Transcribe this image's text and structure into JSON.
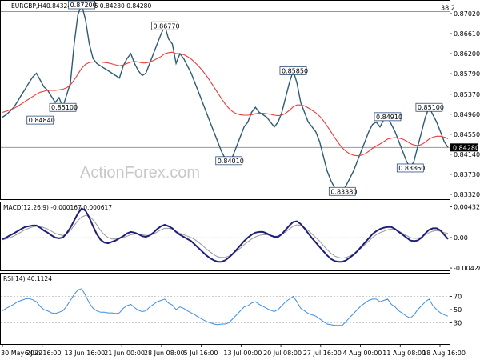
{
  "chart_data": {
    "type": "line",
    "price": {
      "header_symbol": "EURGBP,H4",
      "header_values": "0.84324 0.84476 0.84280 0.84280",
      "ylim": [
        0.8327,
        0.872
      ],
      "y_ticks": [
        "0.87020",
        "0.86610",
        "0.86200",
        "0.85790",
        "0.85370",
        "0.84960",
        "0.84550",
        "0.84140",
        "0.83730",
        "0.83320"
      ],
      "current_price": "0.84280",
      "fib_label": "38.2",
      "fib_level": 0.8706,
      "series": [
        {
          "name": "close",
          "color": "#2e5a74",
          "values": [
            0.849,
            0.8495,
            0.8502,
            0.851,
            0.8522,
            0.8535,
            0.8547,
            0.856,
            0.8572,
            0.858,
            0.8566,
            0.8552,
            0.8545,
            0.8532,
            0.852,
            0.853,
            0.851,
            0.8535,
            0.856,
            0.864,
            0.87,
            0.872,
            0.869,
            0.864,
            0.861,
            0.86,
            0.8595,
            0.859,
            0.8585,
            0.858,
            0.8575,
            0.857,
            0.8595,
            0.861,
            0.862,
            0.86,
            0.8585,
            0.8575,
            0.858,
            0.86,
            0.862,
            0.864,
            0.866,
            0.8677,
            0.865,
            0.864,
            0.86,
            0.862,
            0.861,
            0.8595,
            0.858,
            0.856,
            0.854,
            0.852,
            0.85,
            0.848,
            0.846,
            0.844,
            0.842,
            0.8405,
            0.8401,
            0.841,
            0.843,
            0.845,
            0.847,
            0.848,
            0.85,
            0.851,
            0.85,
            0.8495,
            0.849,
            0.848,
            0.847,
            0.848,
            0.85,
            0.853,
            0.856,
            0.8585,
            0.856,
            0.852,
            0.85,
            0.848,
            0.847,
            0.846,
            0.844,
            0.841,
            0.838,
            0.836,
            0.8345,
            0.834,
            0.8338,
            0.835,
            0.8365,
            0.838,
            0.84,
            0.842,
            0.844,
            0.846,
            0.8475,
            0.848,
            0.847,
            0.8485,
            0.8491,
            0.8475,
            0.846,
            0.844,
            0.842,
            0.84,
            0.8386,
            0.84,
            0.843,
            0.846,
            0.849,
            0.851,
            0.8495,
            0.848,
            0.846,
            0.844,
            0.8428
          ]
        },
        {
          "name": "ma",
          "color": "#e83c3c",
          "values": [
            0.85,
            0.8502,
            0.8505,
            0.8508,
            0.8512,
            0.8517,
            0.8522,
            0.8527,
            0.8532,
            0.8537,
            0.8541,
            0.8543,
            0.8545,
            0.8545,
            0.8545,
            0.8546,
            0.8547,
            0.855,
            0.8556,
            0.8566,
            0.8578,
            0.859,
            0.8598,
            0.8602,
            0.8603,
            0.8603,
            0.8603,
            0.8602,
            0.8601,
            0.8599,
            0.8597,
            0.8595,
            0.8597,
            0.86,
            0.8603,
            0.8604,
            0.8603,
            0.8601,
            0.8601,
            0.8603,
            0.8606,
            0.861,
            0.8614,
            0.862,
            0.8622,
            0.8623,
            0.862,
            0.862,
            0.8618,
            0.8614,
            0.8609,
            0.8602,
            0.8594,
            0.8585,
            0.8575,
            0.8564,
            0.8552,
            0.854,
            0.8528,
            0.8517,
            0.8508,
            0.8501,
            0.8497,
            0.8495,
            0.8494,
            0.8494,
            0.8495,
            0.8497,
            0.8498,
            0.8498,
            0.8497,
            0.8496,
            0.8494,
            0.8493,
            0.8494,
            0.8498,
            0.8504,
            0.8511,
            0.8515,
            0.8515,
            0.8513,
            0.8509,
            0.8504,
            0.8499,
            0.8492,
            0.8483,
            0.8472,
            0.846,
            0.8448,
            0.8437,
            0.8427,
            0.842,
            0.8415,
            0.8412,
            0.8411,
            0.8412,
            0.8415,
            0.842,
            0.8426,
            0.8431,
            0.8435,
            0.844,
            0.8445,
            0.8447,
            0.8448,
            0.8447,
            0.8445,
            0.8441,
            0.8436,
            0.8433,
            0.8432,
            0.8434,
            0.8439,
            0.8445,
            0.8449,
            0.8451,
            0.8451,
            0.8449,
            0.8446
          ]
        }
      ],
      "labels": [
        {
          "text": "0.84840",
          "i": 10,
          "value": 0.8484
        },
        {
          "text": "0.87200",
          "i": 21,
          "value": 0.872
        },
        {
          "text": "0.85100",
          "i": 16,
          "value": 0.851
        },
        {
          "text": "0.86770",
          "i": 43,
          "value": 0.8677
        },
        {
          "text": "0.84010",
          "i": 60,
          "value": 0.8401
        },
        {
          "text": "0.85850",
          "i": 77,
          "value": 0.8585
        },
        {
          "text": "0.83380",
          "i": 90,
          "value": 0.8338
        },
        {
          "text": "0.84910",
          "i": 102,
          "value": 0.8491
        },
        {
          "text": "0.83860",
          "i": 108,
          "value": 0.8386
        },
        {
          "text": "0.85100",
          "i": 113,
          "value": 0.851
        }
      ]
    },
    "macd": {
      "header": "MACD(12,26,9) -0.000167 0.000617",
      "ylim": [
        -0.0045,
        0.0045
      ],
      "y_ticks": [
        "0.004325",
        "0.00",
        "-0.004288"
      ],
      "series": [
        {
          "name": "signal",
          "color": "#999999",
          "values": [
            -0.0003,
            -0.0002,
            0.0,
            0.0002,
            0.0005,
            0.0008,
            0.0011,
            0.0013,
            0.0015,
            0.0016,
            0.0016,
            0.0014,
            0.0012,
            0.0009,
            0.0006,
            0.0004,
            0.0003,
            0.0005,
            0.001,
            0.0017,
            0.0024,
            0.0029,
            0.0031,
            0.003,
            0.0025,
            0.0018,
            0.001,
            0.0004,
            0.0,
            -0.0002,
            -0.0002,
            -0.0001,
            0.0,
            0.0002,
            0.0004,
            0.0005,
            0.0005,
            0.0004,
            0.0003,
            0.0003,
            0.0005,
            0.0008,
            0.0011,
            0.0013,
            0.0013,
            0.0012,
            0.0009,
            0.0006,
            0.0004,
            0.0002,
            0.0,
            -0.0003,
            -0.0007,
            -0.0011,
            -0.0016,
            -0.002,
            -0.0024,
            -0.0027,
            -0.0028,
            -0.0028,
            -0.0026,
            -0.0023,
            -0.0019,
            -0.0015,
            -0.001,
            -0.0006,
            -0.0002,
            0.0001,
            0.0003,
            0.0004,
            0.0004,
            0.0003,
            0.0002,
            0.0002,
            0.0004,
            0.0008,
            0.0012,
            0.0016,
            0.0018,
            0.0017,
            0.0014,
            0.001,
            0.0005,
            0.0,
            -0.0005,
            -0.0011,
            -0.0017,
            -0.0022,
            -0.0026,
            -0.0028,
            -0.0029,
            -0.0028,
            -0.0026,
            -0.0023,
            -0.0019,
            -0.0015,
            -0.001,
            -0.0005,
            0.0,
            0.0004,
            0.0007,
            0.0009,
            0.0011,
            0.0012,
            0.0011,
            0.0009,
            0.0006,
            0.0003,
            0.0,
            -0.0001,
            -0.0001,
            0.0001,
            0.0004,
            0.0007,
            0.0009,
            0.001,
            0.0009,
            0.0007,
            0.0006
          ]
        },
        {
          "name": "macd",
          "color": "#1e1e7a",
          "values": [
            -0.0002,
            0.0,
            0.0003,
            0.0006,
            0.0009,
            0.0012,
            0.0015,
            0.0016,
            0.0017,
            0.0017,
            0.0014,
            0.001,
            0.0007,
            0.0003,
            0.0,
            -0.0001,
            0.0,
            0.0006,
            0.0014,
            0.0024,
            0.0034,
            0.0041,
            0.0038,
            0.0028,
            0.0016,
            0.0005,
            -0.0003,
            -0.0007,
            -0.0008,
            -0.0006,
            -0.0004,
            -0.0001,
            0.0002,
            0.0006,
            0.0008,
            0.0007,
            0.0005,
            0.0002,
            0.0001,
            0.0003,
            0.0007,
            0.0012,
            0.0016,
            0.0018,
            0.0016,
            0.0013,
            0.0008,
            0.0004,
            0.0001,
            -0.0002,
            -0.0005,
            -0.001,
            -0.0015,
            -0.002,
            -0.0025,
            -0.0029,
            -0.0032,
            -0.0034,
            -0.0034,
            -0.0032,
            -0.0028,
            -0.0023,
            -0.0017,
            -0.0011,
            -0.0005,
            0.0,
            0.0004,
            0.0007,
            0.0008,
            0.0008,
            0.0006,
            0.0003,
            0.0001,
            0.0001,
            0.0005,
            0.0011,
            0.0017,
            0.0022,
            0.0023,
            0.0019,
            0.0013,
            0.0006,
            -0.0001,
            -0.0007,
            -0.0013,
            -0.0019,
            -0.0025,
            -0.003,
            -0.0033,
            -0.0034,
            -0.0034,
            -0.0032,
            -0.0028,
            -0.0024,
            -0.0019,
            -0.0013,
            -0.0007,
            -0.0001,
            0.0005,
            0.0009,
            0.0012,
            0.0014,
            0.0015,
            0.0015,
            0.0012,
            0.0008,
            0.0004,
            0.0,
            -0.0004,
            -0.0005,
            -0.0004,
            0.0,
            0.0006,
            0.0011,
            0.0013,
            0.0013,
            0.001,
            0.0004,
            -0.0002
          ]
        }
      ]
    },
    "rsi": {
      "header": "RSI(14) 40.1124",
      "ylim": [
        0,
        100
      ],
      "y_ticks": [
        "70",
        "50",
        "30"
      ],
      "series": [
        {
          "name": "rsi",
          "color": "#3d8ee5",
          "values": [
            48,
            52,
            55,
            58,
            62,
            64,
            66,
            67,
            65,
            62,
            55,
            50,
            48,
            45,
            44,
            46,
            48,
            55,
            64,
            73,
            80,
            82,
            72,
            60,
            52,
            48,
            46,
            46,
            45,
            45,
            44,
            45,
            52,
            56,
            58,
            53,
            49,
            47,
            48,
            54,
            58,
            62,
            64,
            66,
            60,
            57,
            50,
            54,
            52,
            48,
            45,
            42,
            38,
            35,
            32,
            30,
            28,
            27,
            28,
            28,
            30,
            36,
            42,
            48,
            54,
            56,
            60,
            62,
            58,
            55,
            52,
            49,
            47,
            50,
            56,
            62,
            66,
            70,
            62,
            52,
            48,
            44,
            42,
            40,
            36,
            32,
            28,
            27,
            26,
            26,
            26,
            32,
            38,
            44,
            50,
            56,
            60,
            64,
            66,
            66,
            62,
            64,
            66,
            58,
            54,
            48,
            44,
            40,
            37,
            42,
            50,
            56,
            62,
            66,
            56,
            50,
            45,
            42,
            40
          ]
        }
      ]
    },
    "x_tick_labels": [
      "30 May 2022",
      "6 Jun 16:00",
      "13 Jun 16:00",
      "21 Jun 00:00",
      "28 Jun 08:00",
      "5 Jul 16:00",
      "13 Jul 00:00",
      "20 Jul 08:00",
      "27 Jul 16:00",
      "4 Aug 00:00",
      "11 Aug 08:00",
      "18 Aug 16:00"
    ],
    "watermark": "ActionForex.com"
  }
}
